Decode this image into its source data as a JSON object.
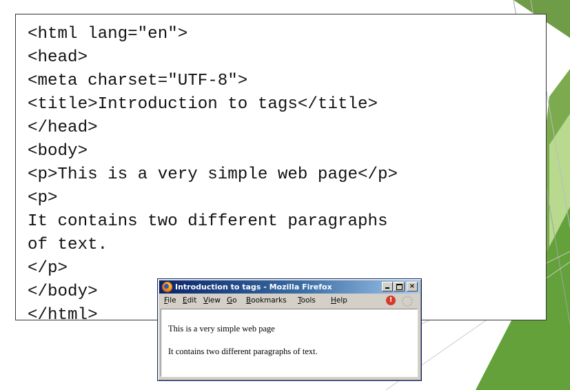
{
  "code_lines": [
    "<html lang=\"en\">",
    "<head>",
    "<meta charset=\"UTF-8\">",
    "<title>Introduction to tags</title>",
    "</head>",
    "<body>",
    "<p>This is a very simple web page</p>",
    "<p>",
    "It contains two different paragraphs",
    "of text.",
    "</p>",
    "</body>",
    "</html>"
  ],
  "browser": {
    "title": "Introduction to tags - Mozilla Firefox",
    "controls": {
      "minimize": "_",
      "maximize": "□",
      "close": "×"
    },
    "menu": [
      {
        "mnemonic": "F",
        "rest": "ile"
      },
      {
        "mnemonic": "E",
        "rest": "dit"
      },
      {
        "mnemonic": "V",
        "rest": "iew"
      },
      {
        "mnemonic": "G",
        "rest": "o"
      },
      {
        "mnemonic": "B",
        "rest": "ookmarks"
      },
      {
        "mnemonic": "T",
        "rest": "ools"
      },
      {
        "mnemonic": "H",
        "rest": "elp"
      }
    ],
    "paragraphs": [
      "This is a very simple web page",
      "It contains two different paragraphs of text."
    ]
  },
  "colors": {
    "title_bar_start": "#0a246a",
    "title_bar_end": "#a6caf0",
    "accent_green_dark": "#5f9335",
    "accent_green_light": "#a8d17a"
  }
}
